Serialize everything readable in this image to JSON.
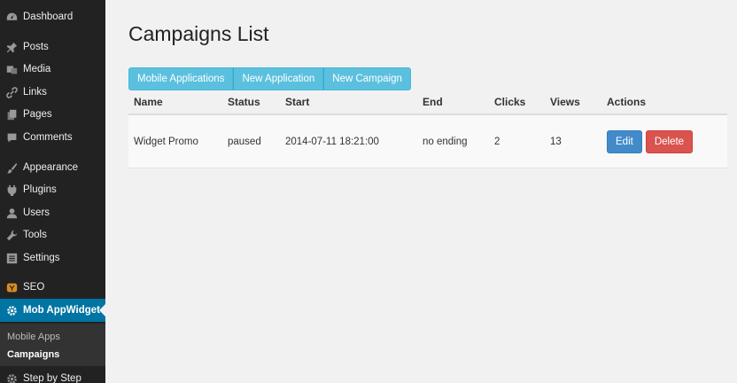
{
  "sidebar": {
    "items": [
      {
        "label": "Dashboard",
        "icon": "dashboard-icon"
      },
      {
        "label": "Posts",
        "icon": "pin-icon"
      },
      {
        "label": "Media",
        "icon": "media-icon"
      },
      {
        "label": "Links",
        "icon": "link-icon"
      },
      {
        "label": "Pages",
        "icon": "pages-icon"
      },
      {
        "label": "Comments",
        "icon": "comment-icon"
      },
      {
        "label": "Appearance",
        "icon": "brush-icon"
      },
      {
        "label": "Plugins",
        "icon": "plug-icon"
      },
      {
        "label": "Users",
        "icon": "user-icon"
      },
      {
        "label": "Tools",
        "icon": "wrench-icon"
      },
      {
        "label": "Settings",
        "icon": "settings-icon"
      },
      {
        "label": "SEO",
        "icon": "seo-icon"
      },
      {
        "label": "Mob AppWidget",
        "icon": "gear-icon"
      },
      {
        "label": "Step by Step",
        "icon": "gear-icon"
      }
    ],
    "submenu": [
      {
        "label": "Mobile Apps"
      },
      {
        "label": "Campaigns"
      }
    ]
  },
  "main": {
    "title": "Campaigns List",
    "buttons": [
      "Mobile Applications",
      "New Application",
      "New Campaign"
    ],
    "columns": [
      "Name",
      "Status",
      "Start",
      "End",
      "Clicks",
      "Views",
      "Actions"
    ],
    "rows": [
      {
        "name": "Widget Promo",
        "status": "paused",
        "start": "2014-07-11 18:21:00",
        "end": "no ending",
        "clicks": "2",
        "views": "13",
        "edit": "Edit",
        "delete": "Delete"
      }
    ]
  },
  "colors": {
    "sidebar": "#222222",
    "active": "#0074a2",
    "info": "#5bc0de",
    "primary": "#428bca",
    "danger": "#d9534f"
  }
}
